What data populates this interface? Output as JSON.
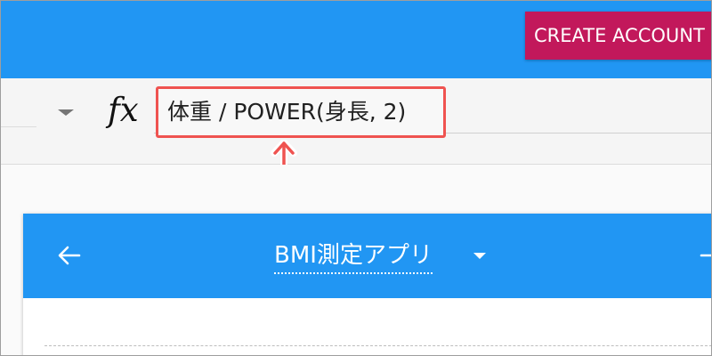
{
  "header": {
    "create_account_label": "CREATE ACCOUNT"
  },
  "formula_bar": {
    "fx_icon": "fx-icon",
    "formula": "体重 / POWER(身長, 2)",
    "highlight_color": "#ef5350"
  },
  "app_preview": {
    "title": "BMI測定アプリ",
    "back_icon": "arrow-left-icon",
    "title_dropdown_icon": "caret-down-icon",
    "forward_icon": "arrow-right-icon"
  },
  "colors": {
    "primary": "#2196f3",
    "accent": "#c2185b",
    "annotation": "#ef5350"
  }
}
